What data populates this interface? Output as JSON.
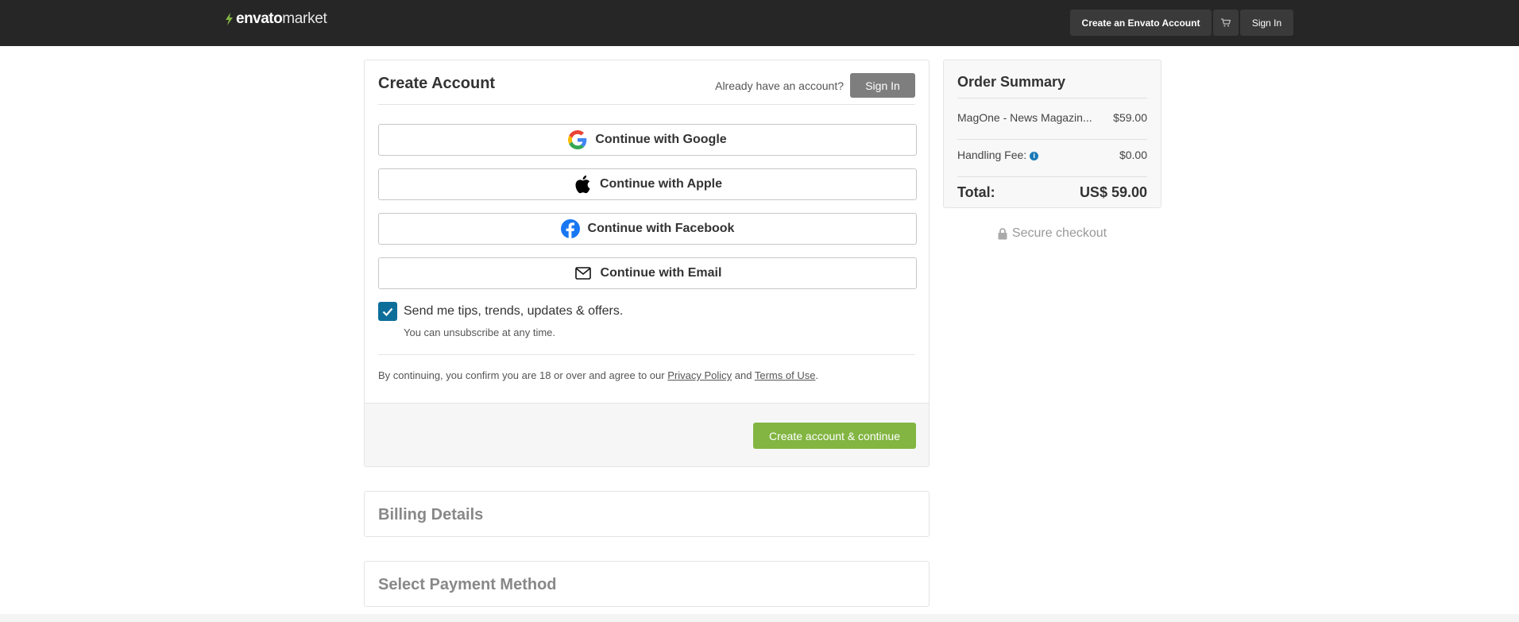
{
  "colors": {
    "topbar": "#262626",
    "accent_green": "#82b541",
    "checkbox_blue": "#0d6e9a",
    "signin_grey": "#7e7e7e"
  },
  "topbar": {
    "logo_brand": "envato",
    "logo_market": "market",
    "create_account": "Create an Envato Account",
    "cart_icon": "cart-icon",
    "sign_in": "Sign In"
  },
  "create_account": {
    "title": "Create Account",
    "already_text": "Already have an account?",
    "sign_in": "Sign In",
    "google": "Continue with Google",
    "apple": "Continue with Apple",
    "facebook": "Continue with Facebook",
    "email": "Continue with Email",
    "tips_checked": true,
    "tips_label": "Send me tips, trends, updates & offers.",
    "unsubscribe": "You can unsubscribe at any time.",
    "legal_prefix": "By continuing, you confirm you are 18 or over and agree to our",
    "privacy_policy": "Privacy Policy",
    "legal_and": "and",
    "terms_of_use": "Terms of Use",
    "legal_suffix": ".",
    "cta": "Create account & continue"
  },
  "sections": {
    "billing": "Billing Details",
    "payment": "Select Payment Method"
  },
  "order_summary": {
    "title": "Order Summary",
    "item_name": "MagOne - News Magazin...",
    "item_price": "$59.00",
    "handling_label": "Handling Fee:",
    "handling_price": "$0.00",
    "total_label": "Total:",
    "total_value": "US$ 59.00"
  },
  "secure_checkout": "Secure checkout"
}
